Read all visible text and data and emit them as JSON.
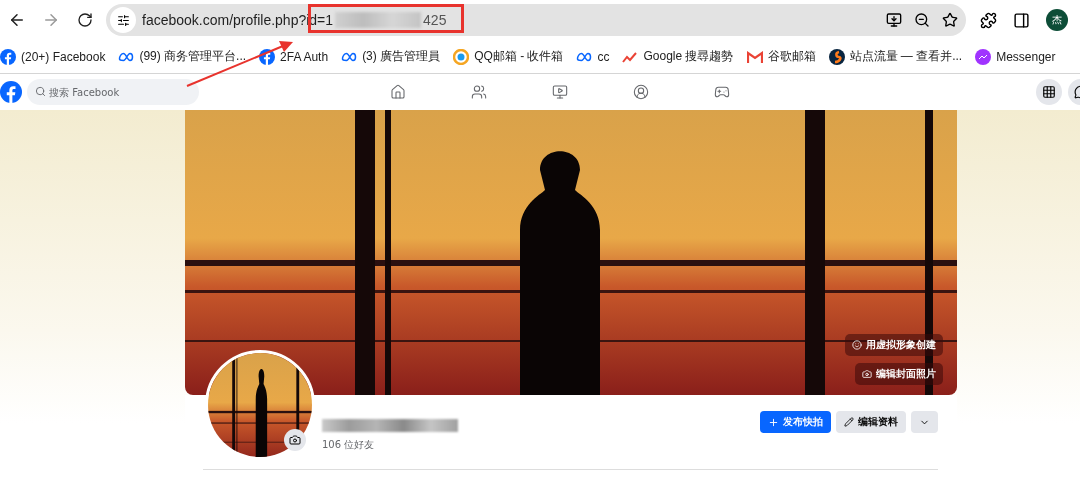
{
  "browser": {
    "nav": [
      {
        "kind": "back",
        "disabled": false
      },
      {
        "kind": "forward",
        "disabled": true
      },
      {
        "kind": "reload",
        "disabled": false
      }
    ],
    "url": {
      "prefix": "facebook.com/profile.php?id=1",
      "suffix": "425"
    },
    "avatar": "杰"
  },
  "bookmarks": [
    {
      "kind": "facebook",
      "label": "(20+) Facebook"
    },
    {
      "kind": "meta",
      "label": "(99) 商务管理平台..."
    },
    {
      "kind": "facebook",
      "label": "2FA Auth"
    },
    {
      "kind": "meta",
      "label": "(3) 廣告管理員"
    },
    {
      "kind": "qq",
      "label": "QQ邮箱 - 收件箱"
    },
    {
      "kind": "meta",
      "label": "cc"
    },
    {
      "kind": "trends",
      "label": "Google 搜尋趨勢"
    },
    {
      "kind": "gmail",
      "label": "谷歌邮箱"
    },
    {
      "kind": "similarweb",
      "label": "站点流量 — 查看并..."
    },
    {
      "kind": "messenger",
      "label": "Messenger"
    }
  ],
  "facebook": {
    "search": {
      "placeholder": "搜索 Facebook"
    },
    "nav": [
      {
        "kind": "home"
      },
      {
        "kind": "friends"
      },
      {
        "kind": "video"
      },
      {
        "kind": "groups"
      },
      {
        "kind": "gaming"
      }
    ]
  },
  "profile": {
    "cover_buttons": [
      {
        "kind": "avatar",
        "label": "用虚拟形象创建"
      },
      {
        "kind": "camera",
        "label": "编辑封面照片"
      }
    ],
    "friends": "106 位好友",
    "actions": [
      {
        "kind": "primary",
        "label": "发布快拍"
      },
      {
        "kind": "secondary",
        "label": "编辑资料"
      },
      {
        "kind": "menu"
      }
    ]
  }
}
